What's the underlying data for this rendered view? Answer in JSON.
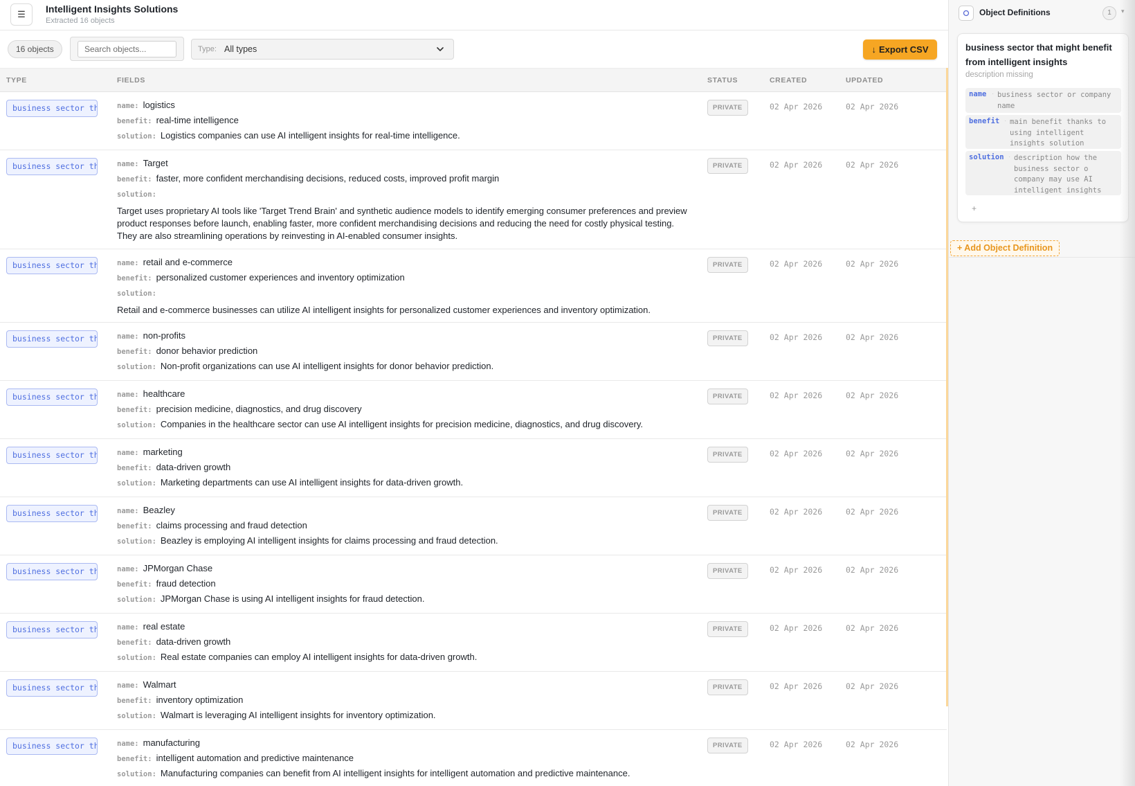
{
  "header": {
    "menu_icon": "hamburger-icon",
    "title": "Intelligent Insights Solutions",
    "subtitle": "Extracted 16 objects"
  },
  "toolbar": {
    "count_label": "16 objects",
    "search_placeholder": "Search objects...",
    "type_label": "Type:",
    "type_value": "All types",
    "export_label": "Export CSV",
    "export_color": "#f6a623"
  },
  "table": {
    "columns": {
      "type": "TYPE",
      "fields": "FIELDS",
      "status": "STATUS",
      "created": "CREATED",
      "updated": "UPDATED"
    },
    "rows": [
      {
        "type": "business sector that might benefit from intelligent insights",
        "name": "logistics",
        "benefit": "real-time intelligence",
        "solution": "Logistics companies can use AI intelligent insights for real-time intelligence.",
        "solution_block": false,
        "status": "PRIVATE",
        "created": "02 Apr 2026",
        "updated": "02 Apr 2026"
      },
      {
        "type": "business sector that might benefit from intelligent insights",
        "name": "Target",
        "benefit": "faster, more confident merchandising decisions, reduced costs, improved profit margin",
        "solution": "Target uses proprietary AI tools like 'Target Trend Brain' and synthetic audience models to identify emerging consumer preferences and preview product responses before launch, enabling faster, more confident merchandising decisions and reducing the need for costly physical testing. They are also streamlining operations by reinvesting in AI-enabled consumer insights.",
        "solution_block": true,
        "status": "PRIVATE",
        "created": "02 Apr 2026",
        "updated": "02 Apr 2026"
      },
      {
        "type": "business sector that might benefit from intelligent insights",
        "name": "retail and e-commerce",
        "benefit": "personalized customer experiences and inventory optimization",
        "solution": "Retail and e-commerce businesses can utilize AI intelligent insights for personalized customer experiences and inventory optimization.",
        "solution_block": true,
        "status": "PRIVATE",
        "created": "02 Apr 2026",
        "updated": "02 Apr 2026"
      },
      {
        "type": "business sector that might benefit from intelligent insights",
        "name": "non-profits",
        "benefit": "donor behavior prediction",
        "solution": "Non-profit organizations can use AI intelligent insights for donor behavior prediction.",
        "solution_block": false,
        "status": "PRIVATE",
        "created": "02 Apr 2026",
        "updated": "02 Apr 2026"
      },
      {
        "type": "business sector that might benefit from intelligent insights",
        "name": "healthcare",
        "benefit": "precision medicine, diagnostics, and drug discovery",
        "solution": "Companies in the healthcare sector can use AI intelligent insights for precision medicine, diagnostics, and drug discovery.",
        "solution_block": false,
        "status": "PRIVATE",
        "created": "02 Apr 2026",
        "updated": "02 Apr 2026"
      },
      {
        "type": "business sector that might benefit from intelligent insights",
        "name": "marketing",
        "benefit": "data-driven growth",
        "solution": "Marketing departments can use AI intelligent insights for data-driven growth.",
        "solution_block": false,
        "status": "PRIVATE",
        "created": "02 Apr 2026",
        "updated": "02 Apr 2026"
      },
      {
        "type": "business sector that might benefit from intelligent insights",
        "name": "Beazley",
        "benefit": "claims processing and fraud detection",
        "solution": "Beazley is employing AI intelligent insights for claims processing and fraud detection.",
        "solution_block": false,
        "status": "PRIVATE",
        "created": "02 Apr 2026",
        "updated": "02 Apr 2026"
      },
      {
        "type": "business sector that might benefit from intelligent insights",
        "name": "JPMorgan Chase",
        "benefit": "fraud detection",
        "solution": "JPMorgan Chase is using AI intelligent insights for fraud detection.",
        "solution_block": false,
        "status": "PRIVATE",
        "created": "02 Apr 2026",
        "updated": "02 Apr 2026"
      },
      {
        "type": "business sector that might benefit from intelligent insights",
        "name": "real estate",
        "benefit": "data-driven growth",
        "solution": "Real estate companies can employ AI intelligent insights for data-driven growth.",
        "solution_block": false,
        "status": "PRIVATE",
        "created": "02 Apr 2026",
        "updated": "02 Apr 2026"
      },
      {
        "type": "business sector that might benefit from intelligent insights",
        "name": "Walmart",
        "benefit": "inventory optimization",
        "solution": "Walmart is leveraging AI intelligent insights for inventory optimization.",
        "solution_block": false,
        "status": "PRIVATE",
        "created": "02 Apr 2026",
        "updated": "02 Apr 2026"
      },
      {
        "type": "business sector that might benefit from intelligent insights",
        "name": "manufacturing",
        "benefit": "intelligent automation and predictive maintenance",
        "solution": "Manufacturing companies can benefit from AI intelligent insights for intelligent automation and predictive maintenance.",
        "solution_block": false,
        "status": "PRIVATE",
        "created": "02 Apr 2026",
        "updated": "02 Apr 2026"
      }
    ]
  },
  "panel": {
    "title": "Object Definitions",
    "count": "1",
    "definition": {
      "title": "business sector that might benefit from intelligent insights",
      "description": "description missing",
      "fields": [
        {
          "key": "name",
          "value": "business sector or company name"
        },
        {
          "key": "benefit",
          "value": "main benefit thanks to using intelligent insights solution"
        },
        {
          "key": "solution",
          "value": "description how the business sector o company may use AI intelligent insights"
        }
      ],
      "add_field": "+"
    },
    "add_definition_label": "+ Add Object Definition"
  },
  "colors": {
    "accent": "#f6a623",
    "type_tag": "#4f6fe0",
    "status_private": "#999999"
  }
}
